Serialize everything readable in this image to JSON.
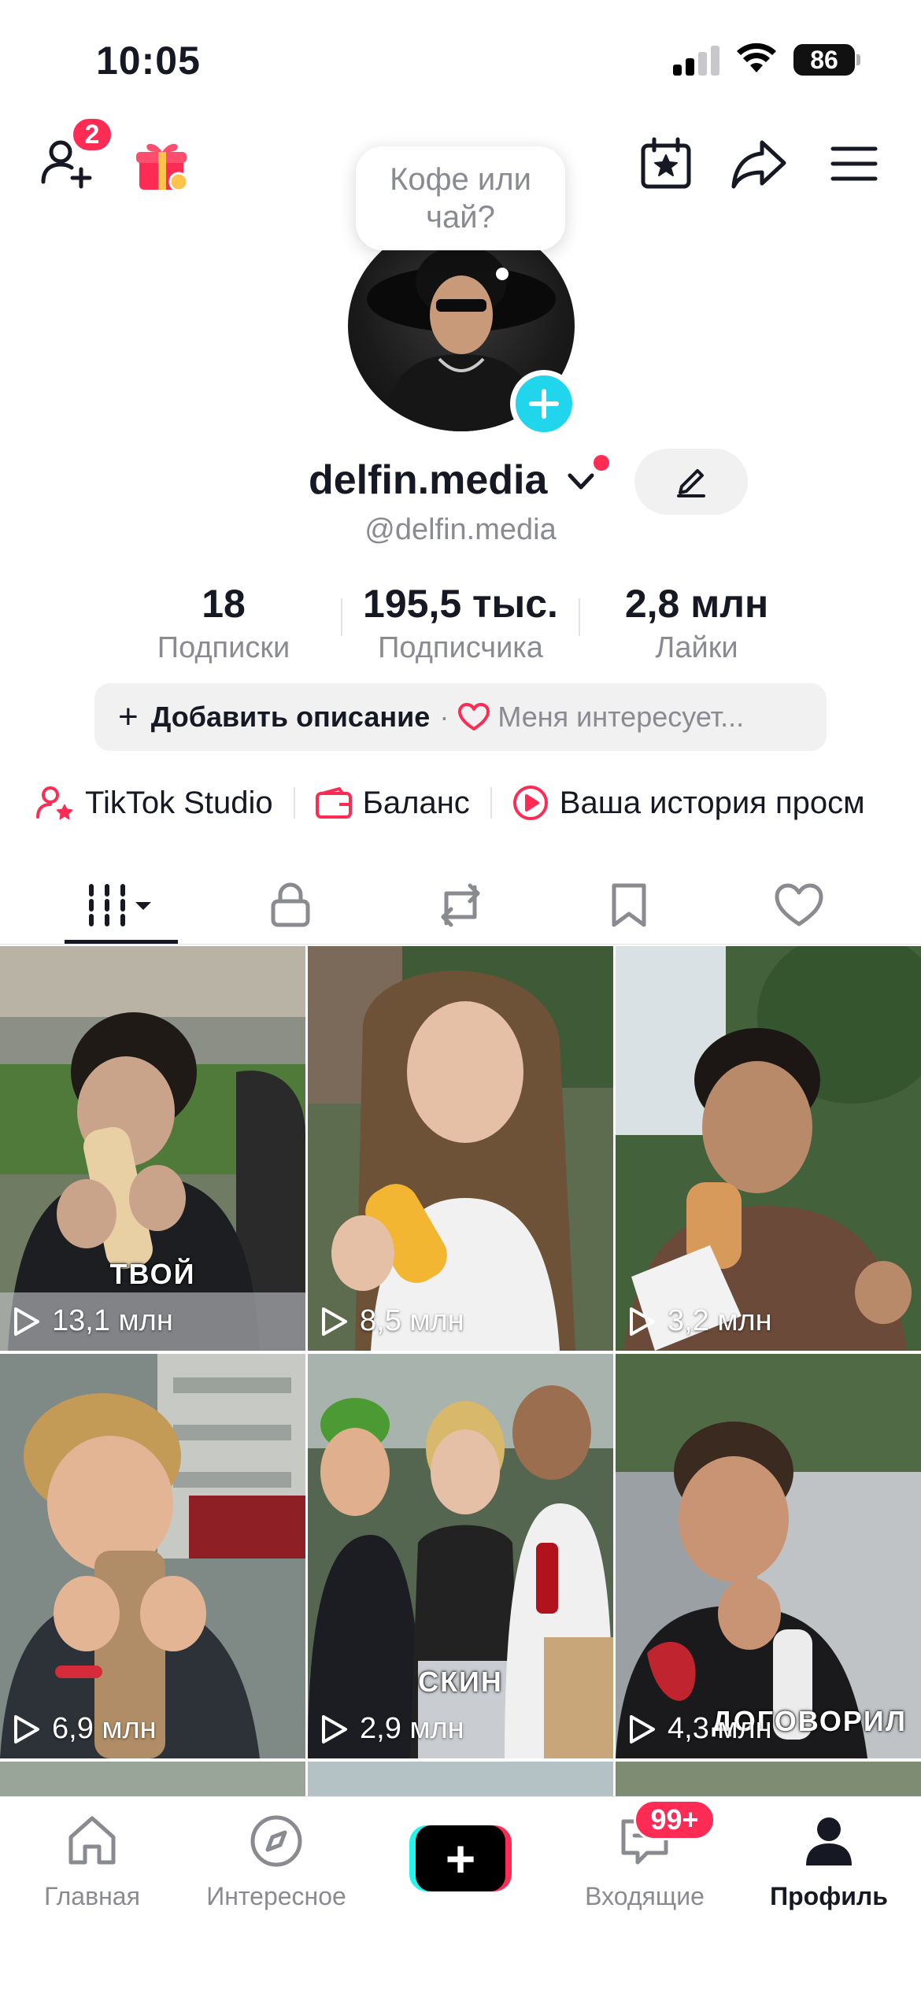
{
  "status_bar": {
    "time": "10:05",
    "battery": "86"
  },
  "header": {
    "friends_badge": "2"
  },
  "profile": {
    "bubble_text": "Кофе или чай?",
    "username": "delfin.media",
    "handle": "@delfin.media"
  },
  "stats": [
    {
      "value": "18",
      "label": "Подписки"
    },
    {
      "value": "195,5 тыс.",
      "label": "Подписчика"
    },
    {
      "value": "2,8 млн",
      "label": "Лайки"
    }
  ],
  "description": {
    "add_label": "Добавить описание",
    "separator": "·",
    "interests_label": "Меня интересует..."
  },
  "shortcuts": [
    {
      "label": "TikTok Studio",
      "icon": "person-star-icon"
    },
    {
      "label": "Баланс",
      "icon": "wallet-icon"
    },
    {
      "label": "Ваша история просм",
      "icon": "play-circle-icon"
    }
  ],
  "tabs": [
    {
      "icon": "videos-grid-icon",
      "active": true
    },
    {
      "icon": "lock-icon"
    },
    {
      "icon": "repost-icon"
    },
    {
      "icon": "bookmark-icon"
    },
    {
      "icon": "heart-icon"
    }
  ],
  "videos": [
    {
      "views": "13,1 млн",
      "caption": "ТВОЙ"
    },
    {
      "views": "8,5 млн",
      "caption": ""
    },
    {
      "views": "3,2 млн",
      "caption": ""
    },
    {
      "views": "6,9 млн",
      "caption": ""
    },
    {
      "views": "2,9 млн",
      "caption": "СКИН"
    },
    {
      "views": "4,3 млн",
      "caption": "ДОГОВОРИЛ"
    }
  ],
  "bottom_nav": {
    "home": "Главная",
    "discover": "Интересное",
    "create": "+",
    "inbox": "Входящие",
    "inbox_badge": "99+",
    "profile": "Профиль"
  },
  "colors": {
    "accent_red": "#fe2c55",
    "accent_cyan": "#25f4ee",
    "avatar_add": "#20d5ec",
    "text_primary": "#161823",
    "text_secondary": "#8a8b91"
  }
}
